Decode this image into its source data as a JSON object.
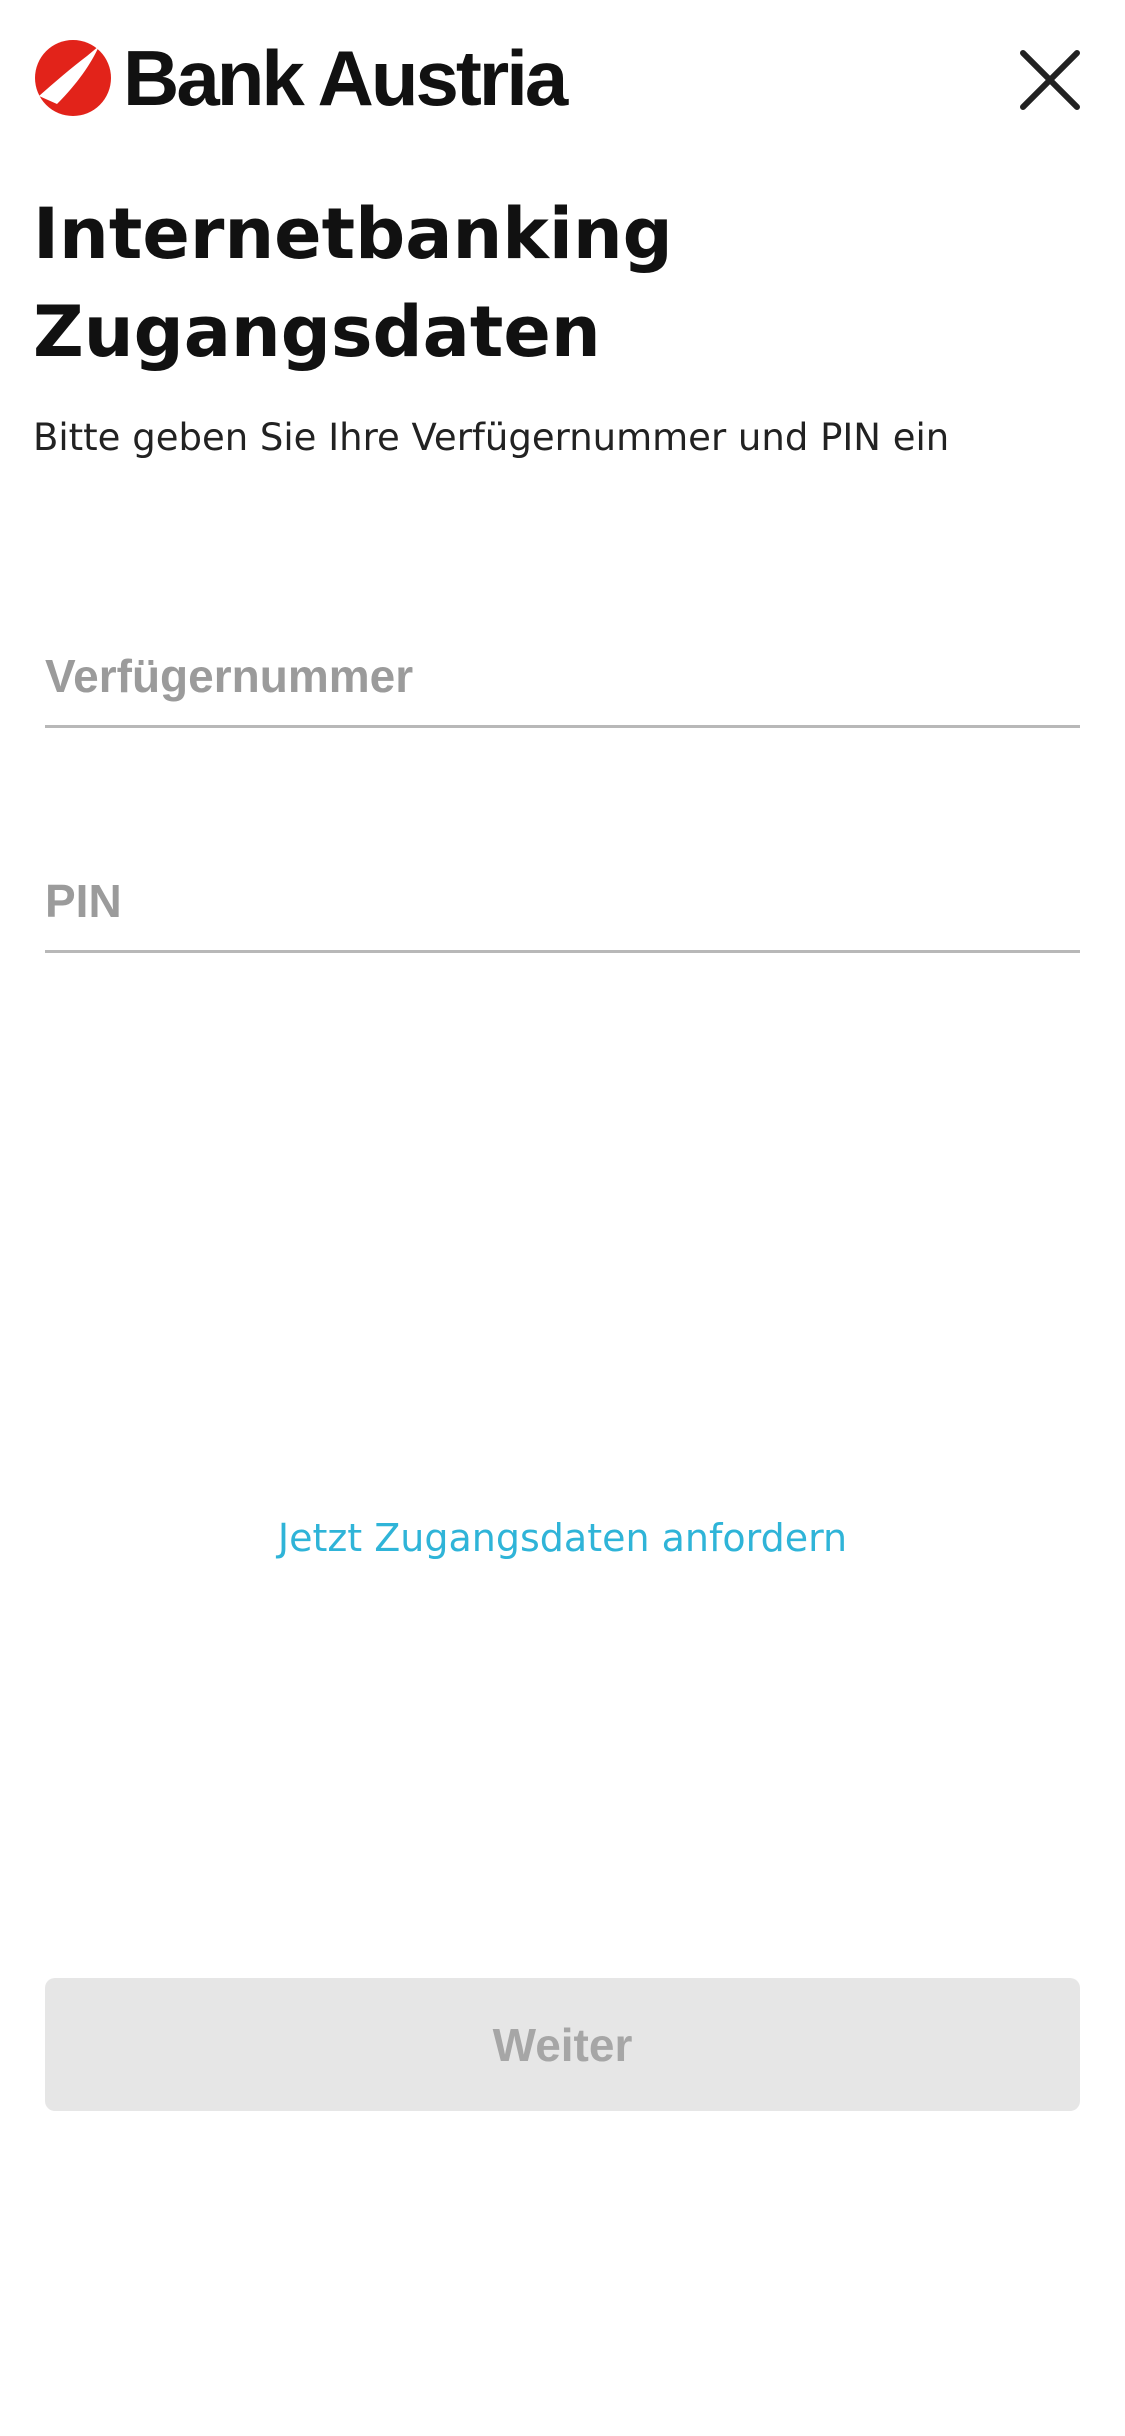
{
  "header": {
    "brand_name": "Bank Austria",
    "logo_icon": "unicredit-logo-icon",
    "close_icon": "close-icon",
    "brand_color": "#e2231a"
  },
  "main": {
    "title": "Internetbanking Zugangsdaten",
    "subtitle": "Bitte geben Sie Ihre Verfügernummer und PIN ein"
  },
  "form": {
    "account_number": {
      "placeholder": "Verfügernummer",
      "value": ""
    },
    "pin": {
      "placeholder": "PIN",
      "value": ""
    }
  },
  "links": {
    "request_credentials": "Jetzt Zugangsdaten anfordern",
    "link_color": "#2fb4d8"
  },
  "actions": {
    "continue_label": "Weiter",
    "continue_state": "disabled"
  }
}
